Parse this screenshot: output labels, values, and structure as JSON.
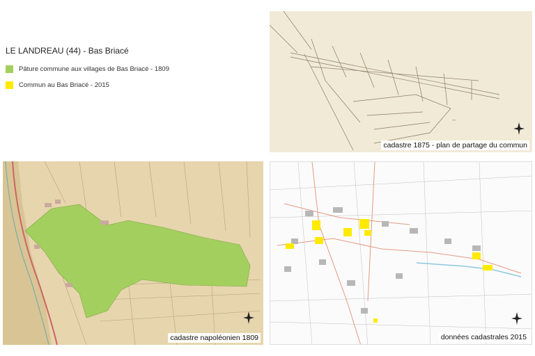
{
  "legend": {
    "title": "LE LANDREAU (44) - Bas Briacé",
    "items": [
      {
        "label": "Pâture commune aux villages de Bas Briacé - 1809",
        "color": "#a3cf5e"
      },
      {
        "label": "Commun au Bas Briacé - 2015",
        "color": "#ffea00"
      }
    ]
  },
  "panels": {
    "p1875": {
      "caption": "cadastre 1875 - plan de partage du commun"
    },
    "p1809": {
      "caption": "cadastre napoléonien 1809"
    },
    "p2015": {
      "caption": "données cadastrales 2015"
    }
  },
  "north_label": "N"
}
